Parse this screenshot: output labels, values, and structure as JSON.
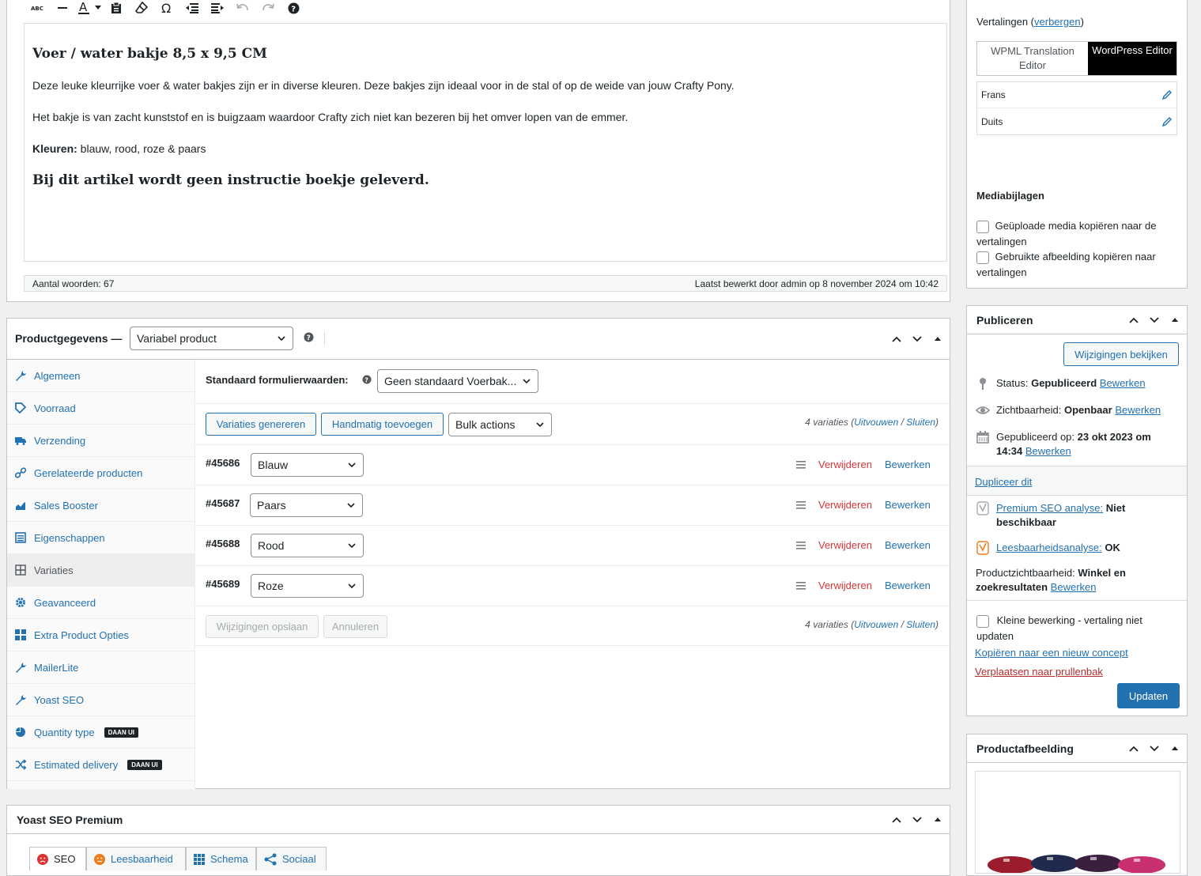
{
  "editor": {
    "heading": "Voer / water bakje 8,5 x 9,5 CM",
    "paragraph1": "Deze leuke kleurrijke voer & water bakjes zijn er in diverse kleuren. Deze bakjes zijn ideaal voor in de stal of op de weide van jouw Crafty Pony.",
    "paragraph2": "Het bakje is van zacht kunststof en is buigzaam waardoor Crafty zich niet kan bezeren bij het omver lopen van de emmer.",
    "colors_label": "Kleuren:",
    "colors_value": " blauw, rood, roze & paars",
    "note": "Bij dit artikel wordt geen instructie boekje geleverd.",
    "word_count": "Aantal woorden: 67",
    "last_edited": "Laatst bewerkt door admin op 8 november 2024 om 10:42",
    "toolbar_icons": [
      "spellcheck-icon",
      "horizontal-line-icon",
      "text-color-icon",
      "paste-text-icon",
      "clear-format-icon",
      "special-char-icon",
      "outdent-icon",
      "indent-icon",
      "undo-icon",
      "redo-icon",
      "help-icon"
    ]
  },
  "product_data": {
    "title": "Productgegevens —",
    "type_select": "Variabel product",
    "tabs": [
      {
        "label": "Algemeen",
        "icon": "wrench-icon"
      },
      {
        "label": "Voorraad",
        "icon": "tag-icon"
      },
      {
        "label": "Verzending",
        "icon": "truck-icon"
      },
      {
        "label": "Gerelateerde producten",
        "icon": "link-icon"
      },
      {
        "label": "Sales Booster",
        "icon": "chart-icon"
      },
      {
        "label": "Eigenschappen",
        "icon": "table-icon"
      },
      {
        "label": "Variaties",
        "icon": "grid-icon"
      },
      {
        "label": "Geavanceerd",
        "icon": "gear-icon"
      },
      {
        "label": "Extra Product Opties",
        "icon": "blocks-icon"
      },
      {
        "label": "MailerLite",
        "icon": "wrench-icon"
      },
      {
        "label": "Yoast SEO",
        "icon": "wrench-icon"
      },
      {
        "label": "Quantity type",
        "icon": "pie-icon",
        "badge": "DAAN UI"
      },
      {
        "label": "Estimated delivery",
        "icon": "shuffle-icon",
        "badge": "DAAN UI"
      }
    ],
    "default_form_label": "Standaard formulierwaarden:",
    "default_form_value": "Geen standaard Voerbak...",
    "generate_btn": "Variaties genereren",
    "manual_btn": "Handmatig toevoegen",
    "bulk_select": "Bulk actions",
    "count_text": "4 variaties (",
    "expand": "Uitvouwen",
    "sep": " / ",
    "close": "Sluiten",
    "close_paren": ")",
    "variations": [
      {
        "id": "#45686",
        "value": "Blauw"
      },
      {
        "id": "#45687",
        "value": "Paars"
      },
      {
        "id": "#45688",
        "value": "Rood"
      },
      {
        "id": "#45689",
        "value": "Roze"
      }
    ],
    "remove_label": "Verwijderen",
    "edit_label": "Bewerken",
    "save_btn": "Wijzigingen opslaan",
    "cancel_btn": "Annuleren"
  },
  "yoast": {
    "title": "Yoast SEO Premium",
    "tabs": [
      "SEO",
      "Leesbaarheid",
      "Schema",
      "Sociaal"
    ]
  },
  "translations": {
    "label": "Vertalingen",
    "toggle": "verbergen",
    "wpml_btn": "WPML Translation Editor",
    "wp_btn": "WordPress Editor",
    "languages": [
      "Frans",
      "Duits"
    ],
    "media_title": "Mediabijlagen",
    "media_opt1": "Geüploade media kopiëren naar de vertalingen",
    "media_opt2": "Gebruikte afbeelding kopiëren naar vertalingen"
  },
  "publish": {
    "title": "Publiceren",
    "view_changes": "Wijzigingen bekijken",
    "status_label": "Status: ",
    "status_value": "Gepubliceerd",
    "visibility_label": "Zichtbaarheid: ",
    "visibility_value": "Openbaar",
    "published_label": "Gepubliceerd op: ",
    "published_value": "23 okt 2023 om 14:34",
    "edit": "Bewerken",
    "duplicate": "Dupliceer dit",
    "seo_label": "Premium SEO analyse:",
    "seo_value": "Niet beschikbaar",
    "read_label": "Leesbaarheidsanalyse:",
    "read_value": "OK",
    "vis_label": "Productzichtbaarheid: ",
    "vis_value": "Winkel en zoekresultaten",
    "minor_edit": "Kleine bewerking - vertaling niet updaten",
    "copy_draft": "Kopiëren naar een nieuw concept",
    "trash": "Verplaatsen naar prullenbak",
    "update_btn": "Updaten"
  },
  "product_image": {
    "title": "Productafbeelding"
  },
  "colors": {
    "accent": "#2271b1",
    "danger": "#d63638",
    "primary_btn": "#2271b1"
  }
}
